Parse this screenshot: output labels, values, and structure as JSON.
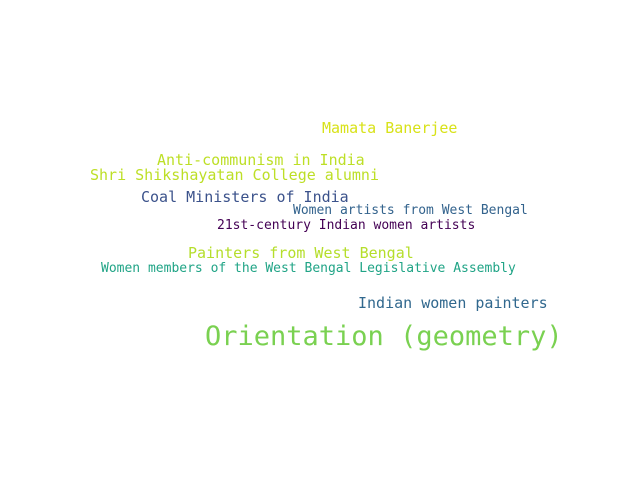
{
  "words": [
    {
      "text": "Mamata Banerjee",
      "color": "#d8e219"
    },
    {
      "text": "Anti-communism in India",
      "color": "#bddf26"
    },
    {
      "text": "Shri Shikshayatan College alumni",
      "color": "#bddf26"
    },
    {
      "text": "Coal Ministers of India",
      "color": "#3b528b"
    },
    {
      "text": "Women artists from West Bengal",
      "color": "#33638d"
    },
    {
      "text": "21st-century Indian women artists",
      "color": "#440154"
    },
    {
      "text": "Painters from West Bengal",
      "color": "#b5de2b"
    },
    {
      "text": "Women members of the West Bengal Legislative Assembly",
      "color": "#20a486"
    },
    {
      "text": "Indian women painters",
      "color": "#31688e"
    },
    {
      "text": "Orientation (geometry)",
      "color": "#7ad151"
    }
  ]
}
